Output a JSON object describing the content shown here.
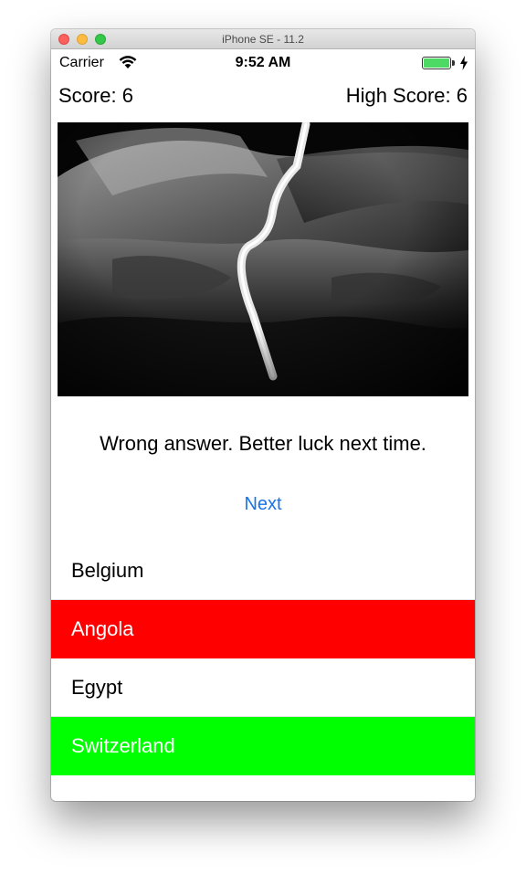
{
  "window": {
    "title": "iPhone SE - 11.2"
  },
  "status_bar": {
    "carrier": "Carrier",
    "time": "9:52 AM",
    "battery_level": 1.0
  },
  "game": {
    "score_text": "Score: 6",
    "high_score_text": "High Score: 6",
    "image_description_icon": "photo-icon",
    "feedback": "Wrong answer. Better luck next time.",
    "next_label": "Next"
  },
  "answers": [
    {
      "label": "Belgium",
      "state": "neutral"
    },
    {
      "label": "Angola",
      "state": "wrong"
    },
    {
      "label": "Egypt",
      "state": "neutral"
    },
    {
      "label": "Switzerland",
      "state": "correct"
    }
  ],
  "colors": {
    "wrong": "#ff0000",
    "correct": "#00ff00",
    "link": "#1a73e8",
    "battery": "#4cd964"
  }
}
